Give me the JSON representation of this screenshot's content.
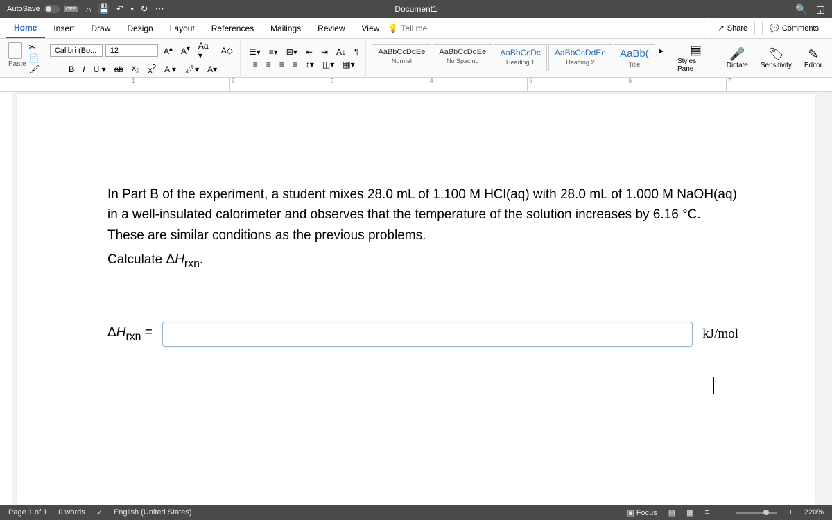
{
  "titlebar": {
    "autosave": "AutoSave",
    "autosave_state": "OFF",
    "doc_title": "Document1"
  },
  "tabs": {
    "items": [
      "Home",
      "Insert",
      "Draw",
      "Design",
      "Layout",
      "References",
      "Mailings",
      "Review",
      "View"
    ],
    "tell_me": "Tell me",
    "share": "Share",
    "comments": "Comments"
  },
  "ribbon": {
    "paste": "Paste",
    "font_name": "Calibri (Bo...",
    "font_size": "12",
    "styles": [
      {
        "preview": "AaBbCcDdEe",
        "label": "Normal"
      },
      {
        "preview": "AaBbCcDdEe",
        "label": "No Spacing"
      },
      {
        "preview": "AaBbCcDc",
        "label": "Heading 1"
      },
      {
        "preview": "AaBbCcDdEe",
        "label": "Heading 2"
      },
      {
        "preview": "AaBb(",
        "label": "Title"
      }
    ],
    "styles_pane": "Styles Pane",
    "dictate": "Dictate",
    "sensitivity": "Sensitivity",
    "editor": "Editor"
  },
  "document": {
    "p1": "In Part B of the experiment, a student mixes 28.0 mL of 1.100 M HCl(aq) with 28.0 mL of 1.000 M NaOH(aq) in a well-insulated calorimeter and observes that the temperature of the solution increases by 6.16 °C. These are similar conditions as the previous problems.",
    "p2_a": "Calculate Δ",
    "p2_b": "H",
    "p2_c": "rxn",
    "p2_d": ".",
    "answer_label_a": "Δ",
    "answer_label_b": "H",
    "answer_label_c": "rxn",
    "answer_label_d": " =",
    "answer_value": "",
    "unit": "kJ/mol"
  },
  "statusbar": {
    "page": "Page 1 of 1",
    "words": "0 words",
    "lang": "English (United States)",
    "focus": "Focus",
    "zoom": "220%"
  }
}
